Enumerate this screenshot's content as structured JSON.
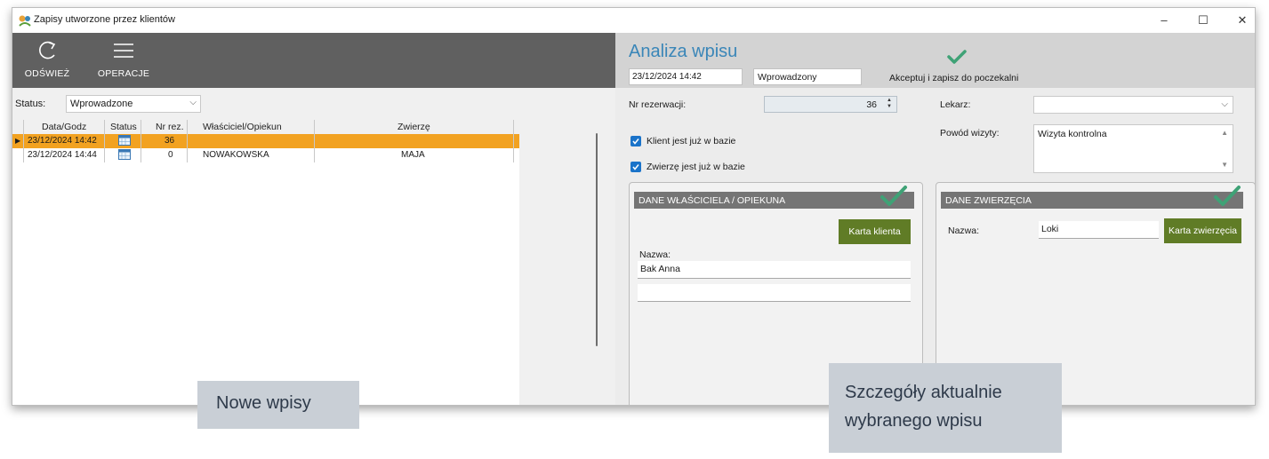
{
  "window": {
    "title": "Zapisy utworzone przez klientów",
    "controls": {
      "minimize": "–",
      "maximize": "☐",
      "close": "✕"
    }
  },
  "toolbar": {
    "refresh_label": "ODŚWIEŻ",
    "operations_label": "OPERACJE"
  },
  "filter": {
    "status_label": "Status:",
    "status_value": "Wprowadzone"
  },
  "grid": {
    "columns": [
      "Data/Godz",
      "Status",
      "Nr rez.",
      "Właściciel/Opiekun",
      "Zwierzę"
    ],
    "rows": [
      {
        "date": "23/12/2024 14:42",
        "status_icon": "calendar-icon",
        "nr": "36",
        "owner": "",
        "pet": "",
        "selected": true
      },
      {
        "date": "23/12/2024 14:44",
        "status_icon": "calendar-icon",
        "nr": "0",
        "owner": "NOWAKOWSKA",
        "pet": "MAJA",
        "selected": false
      }
    ]
  },
  "detail": {
    "title": "Analiza wpisu",
    "datetime": "23/12/2024 14:42",
    "state": "Wprowadzony",
    "accept_label": "Akceptuj i zapisz do poczekalni",
    "nr_label": "Nr rezerwacji:",
    "nr_value": "36",
    "client_in_db_label": "Klient jest już w bazie",
    "pet_in_db_label": "Zwierzę jest już w bazie",
    "doctor_label": "Lekarz:",
    "doctor_value": "",
    "reason_label": "Powód wizyty:",
    "reason_value": "Wizyta kontrolna"
  },
  "owner_panel": {
    "title": "DANE WŁAŚCICIELA / OPIEKUNA",
    "card_button": "Karta klienta",
    "name_label": "Nazwa:",
    "name_value": "Bak Anna",
    "second_value": ""
  },
  "pet_panel": {
    "title": "DANE ZWIERZĘCIA",
    "card_button": "Karta zwierzęcia",
    "name_label": "Nazwa:",
    "name_value": "Loki"
  },
  "callouts": {
    "left": "Nowe wpisy",
    "right_line1": "Szczegóły aktualnie",
    "right_line2": "wybranego wpisu"
  },
  "colors": {
    "toolbar_bg": "#606060",
    "selected_row": "#f2a221",
    "title_blue": "#3a86b8",
    "check_green": "#3fa276",
    "button_green": "#607c26",
    "checkbox_blue": "#1a73c9",
    "callout_bg": "#c9cfd6"
  }
}
